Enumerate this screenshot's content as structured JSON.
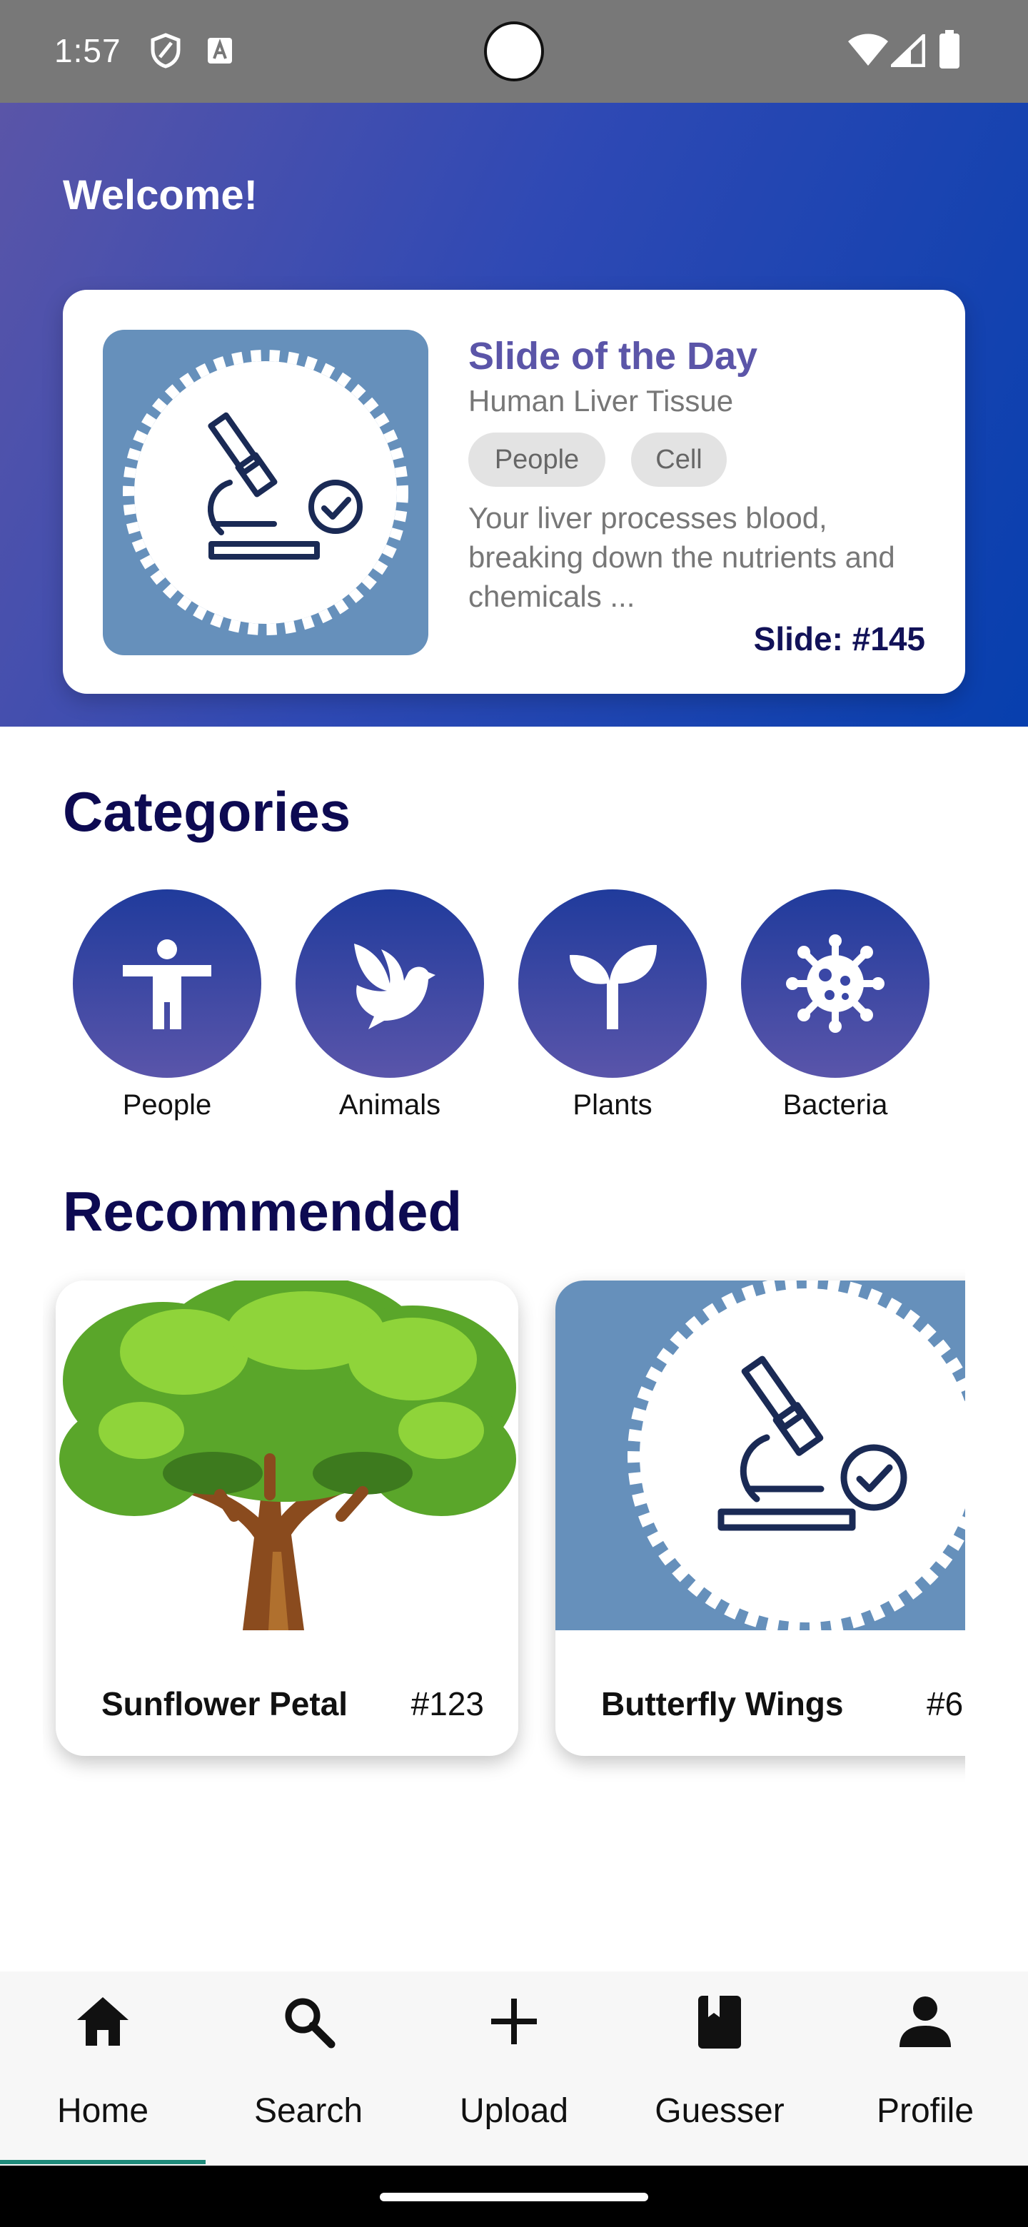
{
  "status_bar": {
    "time": "1:57"
  },
  "hero": {
    "welcome": "Welcome!",
    "slide_card": {
      "title": "Slide of the Day",
      "subtitle": "Human Liver Tissue",
      "chips": [
        "People",
        "Cell"
      ],
      "description": "Your liver processes blood, breaking down the nutrients and chemicals ...",
      "slide_number": "Slide: #145"
    }
  },
  "categories": {
    "title": "Categories",
    "items": [
      {
        "label": "People",
        "icon": "person-arms-out-icon"
      },
      {
        "label": "Animals",
        "icon": "bird-icon"
      },
      {
        "label": "Plants",
        "icon": "sprout-icon"
      },
      {
        "label": "Bacteria",
        "icon": "virus-icon"
      }
    ]
  },
  "recommended": {
    "title": "Recommended",
    "items": [
      {
        "name": "Sunflower Petal",
        "number": "#123",
        "image": "tree-image"
      },
      {
        "name": "Butterfly Wings",
        "number": "#6",
        "image": "microscope-placeholder-image"
      }
    ]
  },
  "bottom_nav": {
    "items": [
      {
        "label": "Home",
        "icon": "home-icon",
        "active": true
      },
      {
        "label": "Search",
        "icon": "search-icon",
        "active": false
      },
      {
        "label": "Upload",
        "icon": "plus-icon",
        "active": false
      },
      {
        "label": "Guesser",
        "icon": "book-icon",
        "active": false
      },
      {
        "label": "Profile",
        "icon": "person-icon",
        "active": false
      }
    ]
  },
  "colors": {
    "hero_gradient_start": "#5a55a8",
    "hero_gradient_end": "#073fae",
    "heading": "#0d0a52",
    "accent_title": "#5b55a8",
    "nav_active_indicator": "#1f8a7a",
    "thumb_background": "#6690bb"
  }
}
